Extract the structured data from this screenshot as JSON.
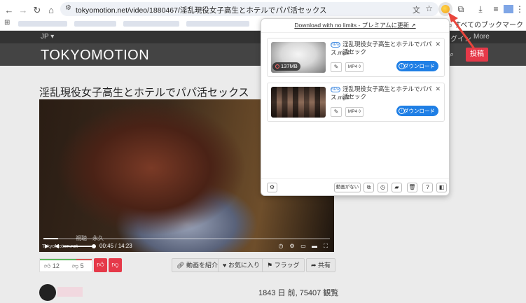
{
  "browser": {
    "url": "tokyomotion.net/video/1880467/淫乱現役女子高生とホテルでパパ活セックス",
    "bookmarks_all_label": "すべてのブックマーク"
  },
  "site": {
    "lang": "JP ▾",
    "login": "グイン",
    "more": "More",
    "logo": "TOKYOMOTION",
    "post_button": "投稿",
    "title": "淫乱現役女子高生とホテルでパパ活セックス",
    "video": {
      "watermark_site": "TokyoMotion.net",
      "watermark_text": "視聴　永久",
      "time": "00:45 / 14:23",
      "progress_fraction": 0.052,
      "volume_fraction": 0.95
    },
    "likes": "12",
    "dislikes": "5",
    "like_fraction": 0.7,
    "actions": {
      "share_video": "動画を紹介",
      "favorite": "お気に入り",
      "flag": "フラッグ",
      "share": "共有"
    },
    "views": "1843 日 前, 75407 観覧"
  },
  "extension": {
    "header_link": "Download with no limits - プレミアムに更新",
    "items": [
      {
        "badge": "NEW",
        "filename_line1": "淫乱現役女子高生とホテルでパパ活セック",
        "filename_line2": "ス.mp4",
        "size": "137MB",
        "format": "MP4 ◊",
        "download_label": "ダウンロード"
      },
      {
        "badge": "NEW",
        "filename_line1": "淫乱現役女子高生とホテルでパパ活セック",
        "filename_line2": "ス.mp4",
        "size": "",
        "format": "MP4 ◊",
        "download_label": "ダウンロード"
      }
    ],
    "footer": {
      "no_video": "動画がない"
    }
  },
  "colors": {
    "accent_red": "#e53949",
    "download_blue": "#1f7fe5"
  }
}
